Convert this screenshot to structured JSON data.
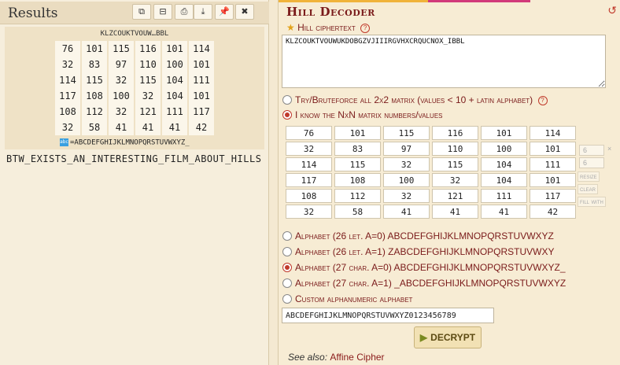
{
  "results": {
    "title": "Results",
    "toolbar": {
      "copy_icon": "⧉",
      "save_icon": "⊟",
      "print_icon": "⎙",
      "download_icon": "⤓",
      "pin_icon": "📌",
      "close_icon": "✖"
    },
    "cipher_short": "KLZCOUKTVOUW…BBL",
    "matrix": [
      [
        "76",
        "101",
        "115",
        "116",
        "101",
        "114"
      ],
      [
        "32",
        "83",
        "97",
        "110",
        "100",
        "101"
      ],
      [
        "114",
        "115",
        "32",
        "115",
        "104",
        "111"
      ],
      [
        "117",
        "108",
        "100",
        "32",
        "104",
        "101"
      ],
      [
        "108",
        "112",
        "32",
        "121",
        "111",
        "117"
      ],
      [
        "32",
        "58",
        "41",
        "41",
        "41",
        "42"
      ]
    ],
    "alphabet_badge": "abc",
    "alphabet": "=ABCDEFGHIJKLMNOPQRSTUVWXYZ_",
    "output": "BTW_EXISTS_AN_INTERESTING_FILM_ABOUT_HILLS"
  },
  "tool": {
    "title": "Hill Decoder",
    "reset_icon": "↺",
    "cipher_label": "Hill ciphertext",
    "cipher_value": "KLZCOUKTVOUWUKDOBGZVJIIIRGVHXCRQUCNOX_IBBL",
    "help": "?",
    "opt_bruteforce": "Try/Bruteforce all 2x2 matrix (values < 10 + latin alphabet)",
    "opt_know": "I know the NxN matrix numbers/values",
    "matrix": [
      [
        "76",
        "101",
        "115",
        "116",
        "101",
        "114"
      ],
      [
        "32",
        "83",
        "97",
        "110",
        "100",
        "101"
      ],
      [
        "114",
        "115",
        "32",
        "115",
        "104",
        "111"
      ],
      [
        "117",
        "108",
        "100",
        "32",
        "104",
        "101"
      ],
      [
        "108",
        "112",
        "32",
        "121",
        "111",
        "117"
      ],
      [
        "32",
        "58",
        "41",
        "41",
        "41",
        "42"
      ]
    ],
    "side": {
      "size_a": "6",
      "times": "×",
      "size_b": "6",
      "resize": "resize",
      "clear": "clear",
      "fill": "fill with"
    },
    "alphabets": [
      "Alphabet (26 let. A=0) ABCDEFGHIJKLMNOPQRSTUVWXYZ",
      "Alphabet (26 let. A=1) ZABCDEFGHIJKLMNOPQRSTUVWXY",
      "Alphabet (27 char. A=0) ABCDEFGHIJKLMNOPQRSTUVWXYZ_",
      "Alphabet (27 char. A=1) _ABCDEFGHIJKLMNOPQRSTUVWXYZ",
      "Custom alphanumeric alphabet"
    ],
    "custom_alpha_value": "ABCDEFGHIJKLMNOPQRSTUVWXYZ0123456789",
    "decrypt_label": "DECRYPT",
    "see_also_label": "See also:",
    "see_also_link": "Affine Cipher"
  },
  "colors": {
    "accent": "#7a1a1a",
    "radio_on": "#c0392b",
    "topbar_orange": "#f0b33a",
    "topbar_pink": "#d23a7a"
  }
}
